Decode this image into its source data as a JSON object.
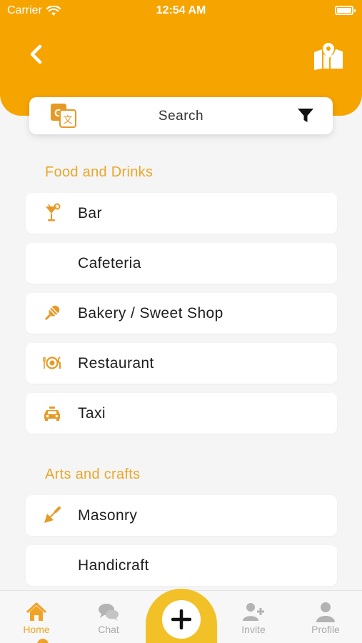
{
  "status_bar": {
    "carrier": "Carrier",
    "time": "12:54 AM"
  },
  "header": {
    "back_icon": "chevron-left-icon",
    "map_icon": "map-pin-icon"
  },
  "search": {
    "label": "Search",
    "translate_icon": "google-translate-icon",
    "filter_icon": "filter-icon"
  },
  "sections": [
    {
      "title": "Food and Drinks",
      "items": [
        {
          "label": "Bar",
          "icon": "cocktail-icon"
        },
        {
          "label": "Cafeteria",
          "icon": ""
        },
        {
          "label": "Bakery / Sweet Shop",
          "icon": "ice-cream-icon"
        },
        {
          "label": "Restaurant",
          "icon": "plate-cutlery-icon"
        },
        {
          "label": "Taxi",
          "icon": "taxi-icon"
        }
      ]
    },
    {
      "title": "Arts and crafts",
      "items": [
        {
          "label": "Masonry",
          "icon": "trowel-icon"
        },
        {
          "label": "Handicraft",
          "icon": ""
        }
      ]
    }
  ],
  "tabbar": {
    "tabs": [
      {
        "label": "Home",
        "icon": "home-icon",
        "active": true
      },
      {
        "label": "Chat",
        "icon": "chat-icon",
        "active": false
      },
      {
        "label": "Invite",
        "icon": "add-user-icon",
        "active": false
      },
      {
        "label": "Profile",
        "icon": "user-icon",
        "active": false
      }
    ],
    "fab_icon": "plus-icon"
  },
  "colors": {
    "accent": "#f6a400",
    "section_title": "#e9a72a",
    "fab": "#f1c127",
    "background": "#f5f5f5"
  }
}
